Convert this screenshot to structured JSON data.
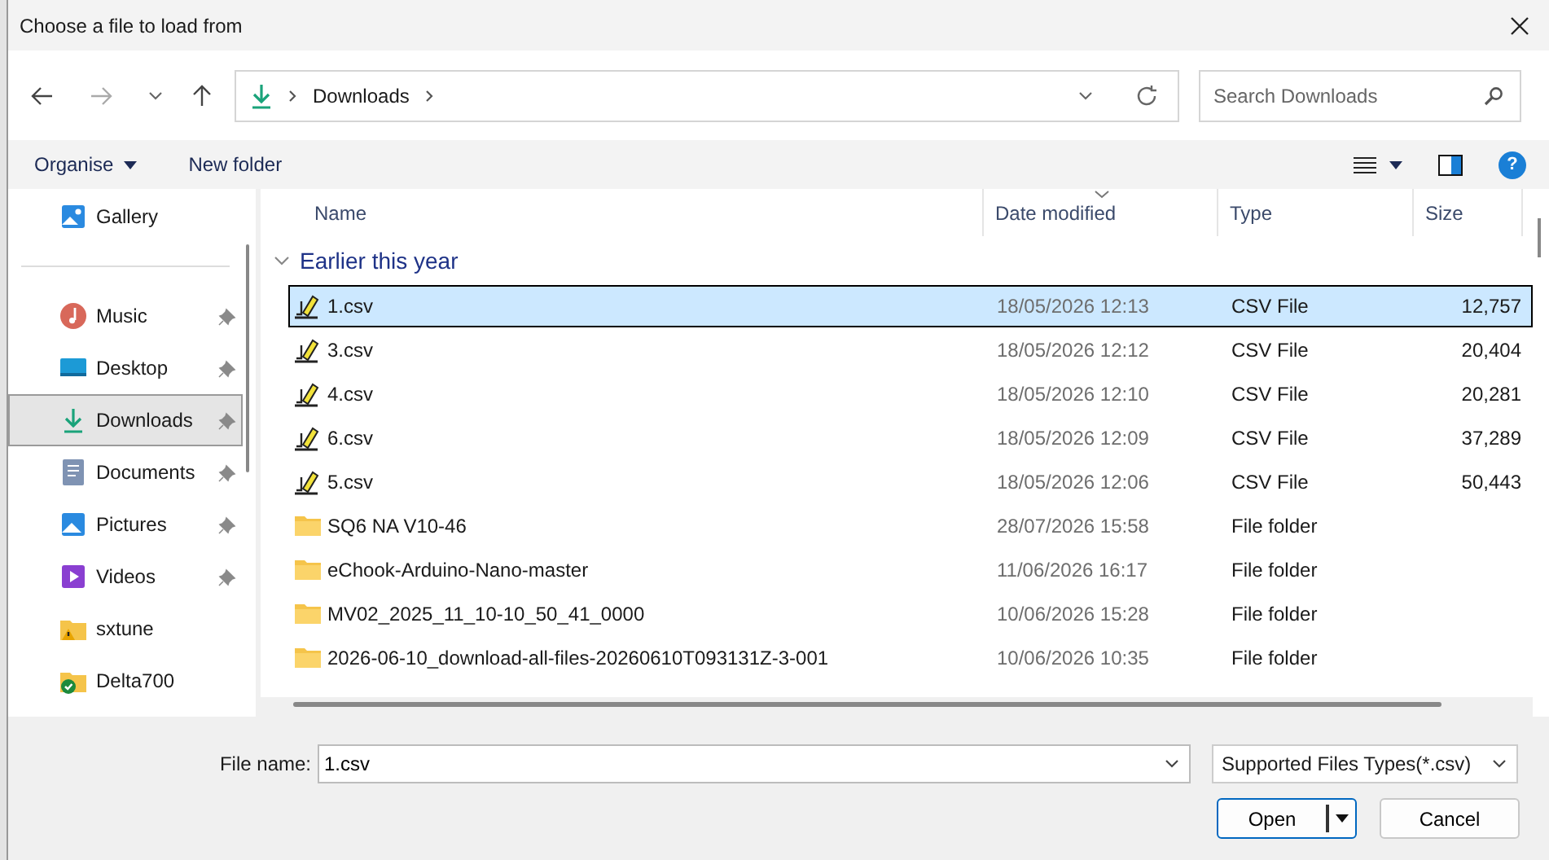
{
  "window": {
    "title": "Choose a file to load from"
  },
  "nav": {
    "address": [
      "Downloads"
    ],
    "search": {
      "placeholder": "Search Downloads"
    }
  },
  "toolbar": {
    "organise": "Organise",
    "new_folder": "New folder",
    "help": "?"
  },
  "sidebar": {
    "sections": [
      {
        "items": [
          {
            "label": "Gallery",
            "kind": "gallery",
            "pinned": false,
            "selected": false
          }
        ]
      },
      {
        "items": [
          {
            "label": "Music",
            "kind": "music",
            "pinned": true,
            "selected": false
          },
          {
            "label": "Desktop",
            "kind": "desktop",
            "pinned": true,
            "selected": false
          },
          {
            "label": "Downloads",
            "kind": "downloads",
            "pinned": true,
            "selected": true
          },
          {
            "label": "Documents",
            "kind": "documents",
            "pinned": true,
            "selected": false
          },
          {
            "label": "Pictures",
            "kind": "pictures",
            "pinned": true,
            "selected": false
          },
          {
            "label": "Videos",
            "kind": "videos",
            "pinned": true,
            "selected": false
          },
          {
            "label": "sxtune",
            "kind": "folder-warning",
            "pinned": false,
            "selected": false
          },
          {
            "label": "Delta700",
            "kind": "folder-synced",
            "pinned": false,
            "selected": false
          }
        ]
      }
    ]
  },
  "table": {
    "columns": [
      {
        "label": "Name",
        "sorted": false
      },
      {
        "label": "Date modified",
        "sorted": true
      },
      {
        "label": "Type",
        "sorted": false
      },
      {
        "label": "Size",
        "sorted": false
      }
    ],
    "groups": [
      {
        "label": "Earlier this year",
        "expanded": true,
        "rows": [
          {
            "name": "1.csv",
            "date": "18/05/2026 12:13",
            "type": "CSV File",
            "size": "12,757",
            "kind": "csv",
            "selected": true
          },
          {
            "name": "3.csv",
            "date": "18/05/2026 12:12",
            "type": "CSV File",
            "size": "20,404",
            "kind": "csv",
            "selected": false
          },
          {
            "name": "4.csv",
            "date": "18/05/2026 12:10",
            "type": "CSV File",
            "size": "20,281",
            "kind": "csv",
            "selected": false
          },
          {
            "name": "6.csv",
            "date": "18/05/2026 12:09",
            "type": "CSV File",
            "size": "37,289",
            "kind": "csv",
            "selected": false
          },
          {
            "name": "5.csv",
            "date": "18/05/2026 12:06",
            "type": "CSV File",
            "size": "50,443",
            "kind": "csv",
            "selected": false
          },
          {
            "name": "SQ6 NA V10-46",
            "date": "28/07/2026 15:58",
            "type": "File folder",
            "kind": "folder",
            "selected": false
          },
          {
            "name": "eChook-Arduino-Nano-master",
            "date": "11/06/2026 16:17",
            "type": "File folder",
            "kind": "folder",
            "selected": false
          },
          {
            "name": "MV02_2025_11_10-10_50_41_0000",
            "date": "10/06/2026 15:28",
            "type": "File folder",
            "kind": "folder",
            "selected": false
          },
          {
            "name": "2026-06-10_download-all-files-20260610T093131Z-3-001",
            "date": "10/06/2026 10:35",
            "type": "File folder",
            "kind": "folder",
            "selected": false
          }
        ]
      }
    ]
  },
  "footer": {
    "file_name_label": "File name:",
    "file_name": "1.csv",
    "filter": "Supported Files Types(*.csv)",
    "buttons": [
      {
        "label": "Open",
        "kind": "split"
      },
      {
        "label": "Cancel",
        "kind": "plain"
      }
    ]
  }
}
